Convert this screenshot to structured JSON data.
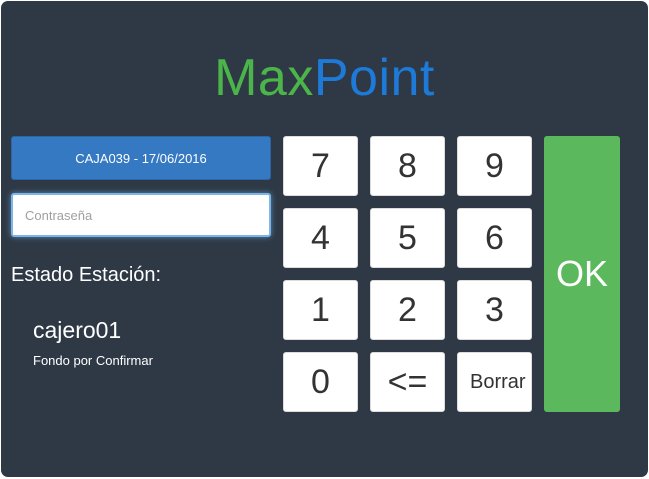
{
  "logo": {
    "part1": "Max",
    "part2": "Point"
  },
  "station": {
    "label": "CAJA039 - 17/06/2016"
  },
  "password": {
    "placeholder": "Contraseña",
    "value": ""
  },
  "estado": {
    "label": "Estado Estación:",
    "user": "cajero01",
    "status": "Fondo por Confirmar"
  },
  "keypad": {
    "k7": "7",
    "k8": "8",
    "k9": "9",
    "k4": "4",
    "k5": "5",
    "k6": "6",
    "k1": "1",
    "k2": "2",
    "k3": "3",
    "k0": "0",
    "back": "<=",
    "clear": "Borrar",
    "ok": "OK"
  },
  "colors": {
    "background": "#2f3946",
    "logo_max": "#4bb54a",
    "logo_point": "#1d7ad8",
    "station_button": "#3479c1",
    "ok_button": "#5cb85c"
  }
}
